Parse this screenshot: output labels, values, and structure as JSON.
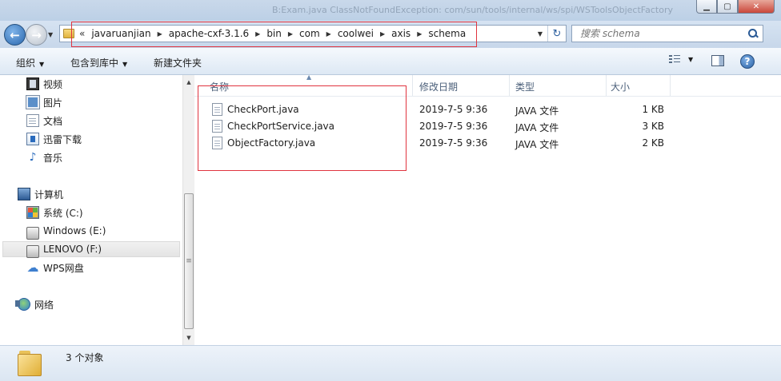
{
  "window": {
    "title_ghost": "B:Exam.java ClassNotFoundException: com/sun/tools/internal/ws/spi/WSToolsObjectFactory"
  },
  "navigation": {
    "overflow_glyph": "«",
    "breadcrumbs": [
      "javaruanjian",
      "apache-cxf-3.1.6",
      "bin",
      "com",
      "coolwei",
      "axis",
      "schema"
    ],
    "search_placeholder": "搜索 schema"
  },
  "toolbar": {
    "organize": "组织",
    "include_in_library": "包含到库中",
    "new_folder": "新建文件夹"
  },
  "sidebar": {
    "items": [
      {
        "label": "视频",
        "icon": "video-icon"
      },
      {
        "label": "图片",
        "icon": "pictures-icon"
      },
      {
        "label": "文档",
        "icon": "documents-icon"
      },
      {
        "label": "迅雷下载",
        "icon": "download-icon"
      },
      {
        "label": "音乐",
        "icon": "music-icon"
      },
      {
        "label": "计算机",
        "icon": "computer-icon"
      },
      {
        "label": "系统 (C:)",
        "icon": "system-drive-icon"
      },
      {
        "label": "Windows (E:)",
        "icon": "drive-icon"
      },
      {
        "label": "LENOVO (F:)",
        "icon": "drive-icon",
        "selected": true
      },
      {
        "label": "WPS网盘",
        "icon": "cloud-icon"
      },
      {
        "label": "网络",
        "icon": "network-icon"
      }
    ]
  },
  "files": {
    "columns": {
      "name": "名称",
      "modified": "修改日期",
      "type": "类型",
      "size": "大小"
    },
    "rows": [
      {
        "name": "CheckPort.java",
        "modified": "2019-7-5 9:36",
        "type": "JAVA 文件",
        "size": "1 KB"
      },
      {
        "name": "CheckPortService.java",
        "modified": "2019-7-5 9:36",
        "type": "JAVA 文件",
        "size": "3 KB"
      },
      {
        "name": "ObjectFactory.java",
        "modified": "2019-7-5 9:36",
        "type": "JAVA 文件",
        "size": "2 KB"
      }
    ]
  },
  "status": {
    "item_count": "3 个对象"
  },
  "colors": {
    "highlight_box": "#e0343f",
    "titlebar": "#c9d8ea"
  }
}
